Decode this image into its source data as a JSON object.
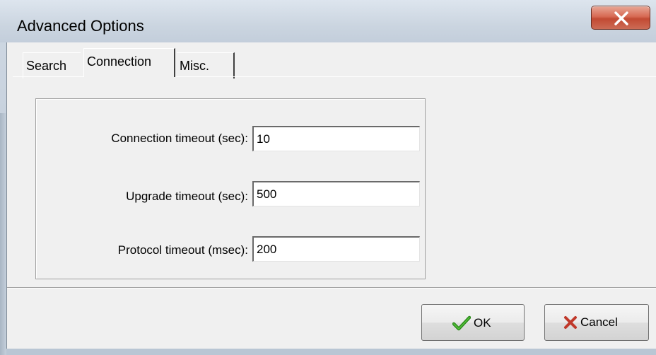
{
  "window": {
    "title": "Advanced Options",
    "close_glyph": "X"
  },
  "tabs": [
    {
      "label": "Search",
      "active": false
    },
    {
      "label": "Connection",
      "active": true
    },
    {
      "label": "Misc.",
      "active": false
    }
  ],
  "connection": {
    "fields": [
      {
        "label": "Connection timeout (sec):",
        "value": "10"
      },
      {
        "label": "Upgrade timeout (sec):",
        "value": "500"
      },
      {
        "label": "Protocol timeout (msec):",
        "value": "200"
      }
    ]
  },
  "buttons": {
    "ok_label": "OK",
    "ok_icon": "checkmark-icon",
    "cancel_label": "Cancel",
    "cancel_icon": "x-mark-icon"
  },
  "colors": {
    "close_button": "#c24a33",
    "checkmark": "#2a8a1a",
    "cancel_x": "#c0392b"
  }
}
